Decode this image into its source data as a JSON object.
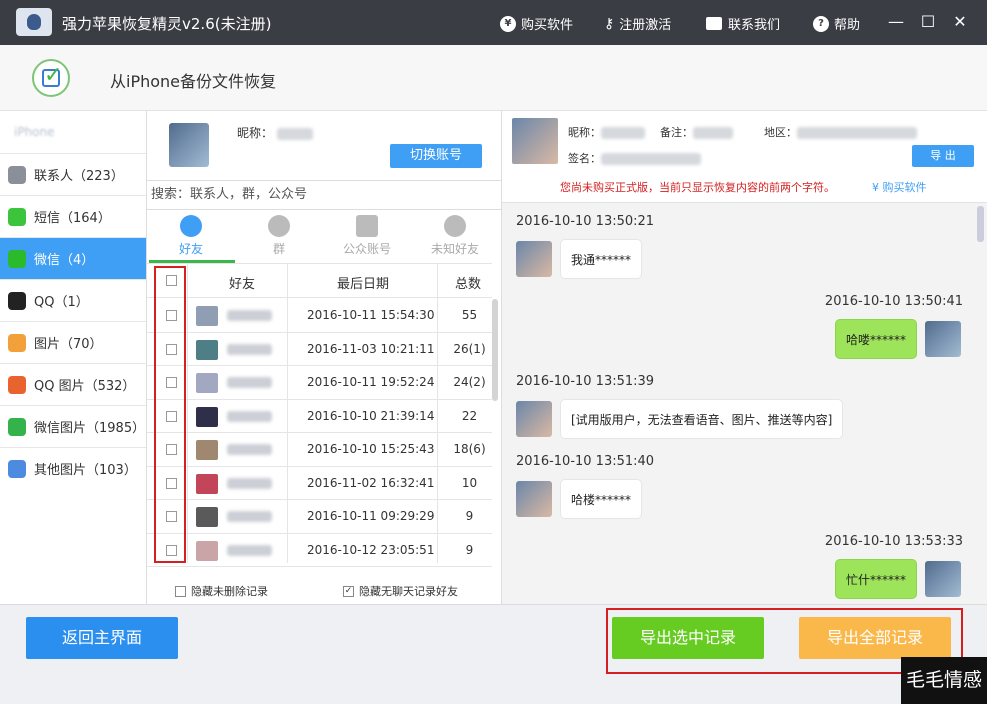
{
  "titlebar": {
    "title": "强力苹果恢复精灵v2.6(未注册)",
    "buy": "购买软件",
    "register": "注册激活",
    "contact": "联系我们",
    "help": "帮助"
  },
  "header": {
    "subtitle": "从iPhone备份文件恢复"
  },
  "sidebar": {
    "items": [
      {
        "label": "联系人（223）",
        "icon": "contacts-icon",
        "color": "#8a8f99"
      },
      {
        "label": "短信（164）",
        "icon": "sms-icon",
        "color": "#3cc43c"
      },
      {
        "label": "微信（4）",
        "icon": "wechat-icon",
        "color": "#2bba2b"
      },
      {
        "label": "QQ（1）",
        "icon": "qq-icon",
        "color": "#222222"
      },
      {
        "label": "图片（70）",
        "icon": "photos-icon",
        "color": "#f2a13a"
      },
      {
        "label": "QQ 图片（532）",
        "icon": "qq-photos-icon",
        "color": "#e8632e"
      },
      {
        "label": "微信图片（1985）",
        "icon": "wechat-photos-icon",
        "color": "#34b34a"
      },
      {
        "label": "其他图片（103）",
        "icon": "other-photos-icon",
        "color": "#4c8be0"
      }
    ],
    "active_index": 2
  },
  "account": {
    "nickname_label": "昵称：",
    "switch_button": "切换账号"
  },
  "search": {
    "placeholder": "搜索：联系人，群，公众号"
  },
  "tabs": [
    {
      "label": "好友",
      "active": true
    },
    {
      "label": "群",
      "active": false
    },
    {
      "label": "公众账号",
      "active": false
    },
    {
      "label": "未知好友",
      "active": false
    }
  ],
  "table": {
    "headers": [
      "好友",
      "最后日期",
      "总数"
    ],
    "rows": [
      {
        "date": "2016-10-11 15:54:30",
        "count": "55",
        "avatar": "#8f9eb2"
      },
      {
        "date": "2016-11-03 10:21:11",
        "count": "26(1)",
        "avatar": "#4e7f86"
      },
      {
        "date": "2016-10-11 19:52:24",
        "count": "24(2)",
        "avatar": "#a3a8c2"
      },
      {
        "date": "2016-10-10 21:39:14",
        "count": "22",
        "avatar": "#2f2f4a"
      },
      {
        "date": "2016-10-10 15:25:43",
        "count": "18(6)",
        "avatar": "#a08870"
      },
      {
        "date": "2016-11-02 16:32:41",
        "count": "10",
        "avatar": "#c2455a"
      },
      {
        "date": "2016-10-11 09:29:29",
        "count": "9",
        "avatar": "#5a5a5a"
      },
      {
        "date": "2016-10-12 23:05:51",
        "count": "9",
        "avatar": "#c9a5a8"
      }
    ]
  },
  "options": {
    "hide_undeleted": "隐藏未删除记录",
    "hide_no_chat": "隐藏无聊天记录好友",
    "hide_no_chat_checked": "✓"
  },
  "contact_detail": {
    "nickname_label": "昵称：",
    "remark_label": "备注：",
    "region_label": "地区：",
    "signature_label": "签名：",
    "export_button": "导 出",
    "notice": "您尚未购买正式版，当前只显示恢复内容的前两个字符。",
    "buy_link": "购买软件"
  },
  "chat": {
    "messages": [
      {
        "time": "2016-10-10 13:50:21",
        "text": "我通******",
        "me": false
      },
      {
        "time": "2016-10-10 13:50:41",
        "text": "哈喽******",
        "me": true
      },
      {
        "time": "2016-10-10 13:51:39",
        "text": "[试用版用户，无法查看语音、图片、推送等内容]",
        "me": false
      },
      {
        "time": "2016-10-10 13:51:40",
        "text": "哈楼******",
        "me": false
      },
      {
        "time": "2016-10-10 13:53:33",
        "text": "忙什******",
        "me": true
      }
    ]
  },
  "footer": {
    "home_button": "返回主界面",
    "export_selected": "导出选中记录",
    "export_all": "导出全部记录"
  },
  "watermark": "毛毛情感吧"
}
